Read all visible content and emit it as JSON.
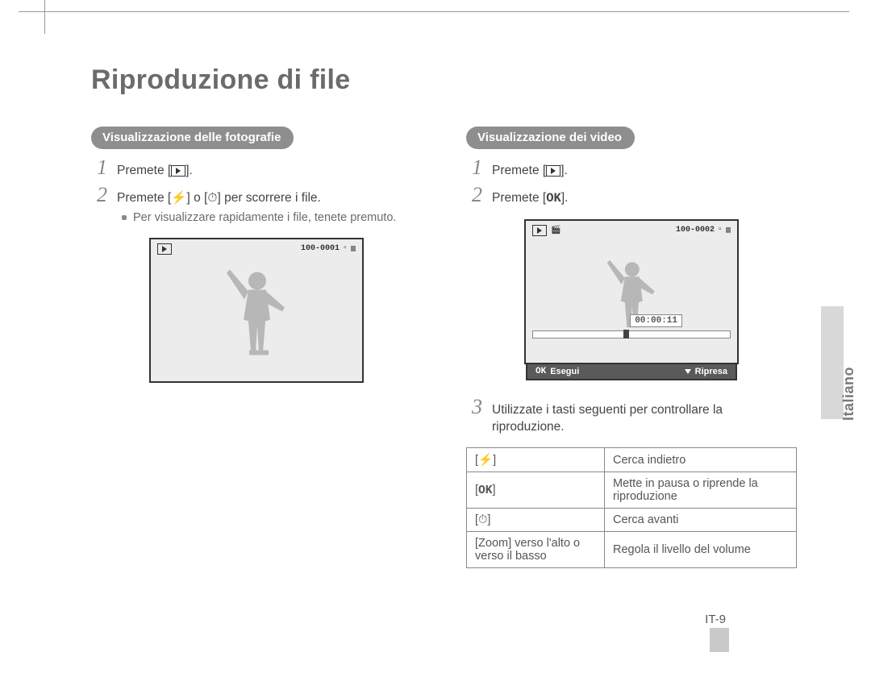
{
  "page": {
    "title": "Riproduzione di file",
    "number": "IT-9",
    "language_tab": "Italiano"
  },
  "glyphs": {
    "playback": "▶",
    "flash": "⚡",
    "timer": "⏱",
    "ok": "OK"
  },
  "left": {
    "pill": "Visualizzazione delle fotografie",
    "step1_pre": "Premete [",
    "step1_post": "].",
    "step2_pre": "Premete [",
    "step2_mid": "] o [",
    "step2_post": "] per scorrere i file.",
    "sub": "Per visualizzare rapidamente i file, tenete premuto.",
    "lcd_counter": "100-0001"
  },
  "right": {
    "pill": "Visualizzazione dei video",
    "step1_pre": "Premete [",
    "step1_post": "].",
    "step2_pre": "Premete [",
    "step2_post": "].",
    "step3": "Utilizzate i tasti seguenti per controllare la riproduzione.",
    "lcd_counter": "100-0002",
    "timecode": "00:00:11",
    "footer_left": "Esegui",
    "footer_right": "Ripresa",
    "table": {
      "r1_k_pre": "[",
      "r1_k_post": "]",
      "r1_v": "Cerca indietro",
      "r2_k_pre": "[",
      "r2_k_post": "]",
      "r2_v": "Mette in pausa o riprende la riproduzione",
      "r3_k_pre": "[",
      "r3_k_post": "]",
      "r3_v": "Cerca avanti",
      "r4_k": "[Zoom] verso l'alto o verso il basso",
      "r4_v": "Regola il livello del volume"
    }
  }
}
